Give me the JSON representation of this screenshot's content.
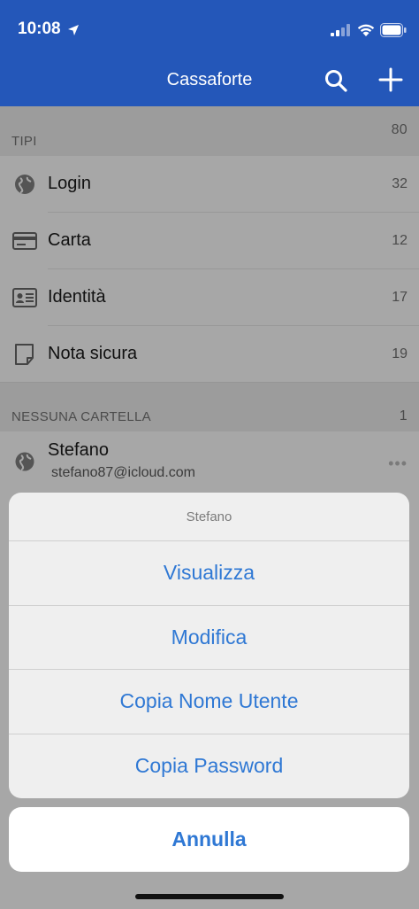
{
  "status_bar": {
    "time": "10:08"
  },
  "nav": {
    "title": "Cassaforte"
  },
  "types_section": {
    "header": "TIPI",
    "count": "80",
    "items": [
      {
        "label": "Login",
        "count": "32",
        "icon": "globe-icon"
      },
      {
        "label": "Carta",
        "count": "12",
        "icon": "credit-card-icon"
      },
      {
        "label": "Identità",
        "count": "17",
        "icon": "id-card-icon"
      },
      {
        "label": "Nota sicura",
        "count": "19",
        "icon": "note-icon"
      }
    ]
  },
  "folder_section": {
    "header": "NESSUNA CARTELLA",
    "count": "1",
    "item": {
      "title": "Stefano",
      "subtitle": "stefano87@icloud.com",
      "icon": "globe-icon",
      "more": "•••"
    }
  },
  "action_sheet": {
    "title": "Stefano",
    "actions": [
      "Visualizza",
      "Modifica",
      "Copia Nome Utente",
      "Copia Password"
    ],
    "cancel": "Annulla"
  },
  "colors": {
    "nav_bar": "#2457b9",
    "action_text": "#2f78d4",
    "dim_background": "#a7a7a7"
  }
}
